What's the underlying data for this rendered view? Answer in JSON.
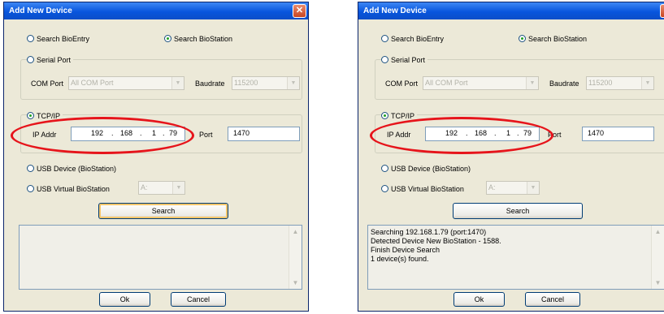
{
  "dialogs": [
    {
      "title": "Add New Device",
      "search_bioentry": "Search BioEntry",
      "search_biostation": "Search BioStation",
      "serial_port": "Serial Port",
      "com_port_label": "COM Port",
      "com_port_value": "All COM Port",
      "baudrate_label": "Baudrate",
      "baudrate_value": "115200",
      "tcpip": "TCP/IP",
      "ip_addr_label": "IP Addr",
      "ip": [
        "192",
        "168",
        "1",
        "79"
      ],
      "port_label": "Port",
      "port_value": "1470",
      "usb_device": "USB Device (BioStation)",
      "usb_virtual": "USB Virtual BioStation",
      "usb_drive_value": "A:",
      "search_button": "Search",
      "ok_button": "Ok",
      "cancel_button": "Cancel",
      "log": [
        "",
        "",
        "",
        ""
      ]
    },
    {
      "title": "Add New Device",
      "search_bioentry": "Search BioEntry",
      "search_biostation": "Search BioStation",
      "serial_port": "Serial Port",
      "com_port_label": "COM Port",
      "com_port_value": "All COM Port",
      "baudrate_label": "Baudrate",
      "baudrate_value": "115200",
      "tcpip": "TCP/IP",
      "ip_addr_label": "IP Addr",
      "ip": [
        "192",
        "168",
        "1",
        "79"
      ],
      "port_label": "Port",
      "port_value": "1470",
      "usb_device": "USB Device (BioStation)",
      "usb_virtual": "USB Virtual BioStation",
      "usb_drive_value": "A:",
      "search_button": "Search",
      "ok_button": "Ok",
      "cancel_button": "Cancel",
      "log": [
        "Searching 192.168.1.79 (port:1470)",
        "Detected Device New BioStation - 1588.",
        "Finish Device Search",
        "1 device(s) found."
      ]
    }
  ],
  "colors": {
    "highlight": "#e6141b",
    "titlebar": "#0855dd"
  }
}
